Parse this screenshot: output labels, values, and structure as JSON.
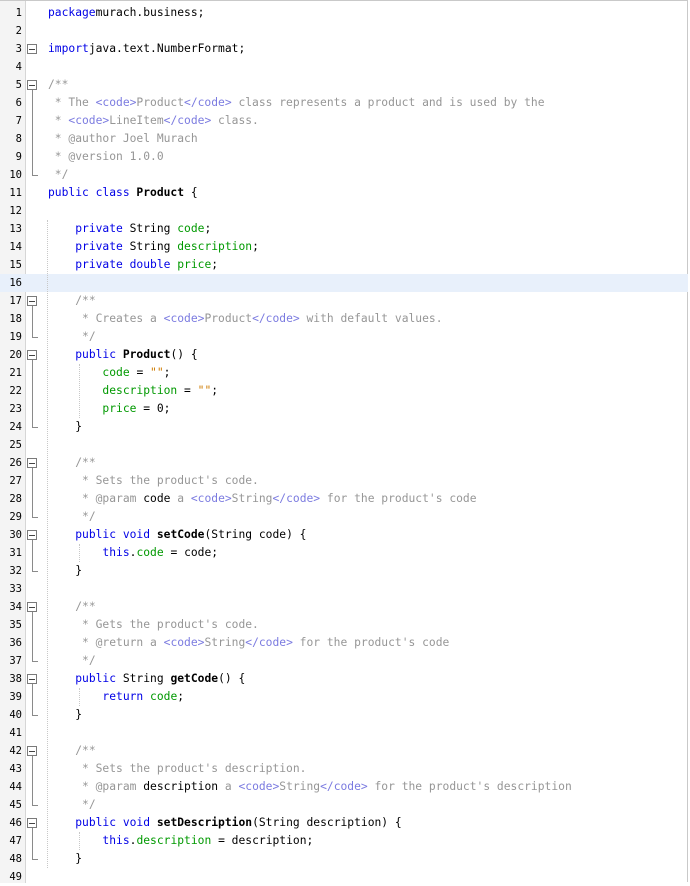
{
  "editor": {
    "lines": [
      {
        "n": "1",
        "segs": [
          [
            "kw",
            "package"
          ],
          [
            "",
            "murach.business;"
          ]
        ]
      },
      {
        "n": "2",
        "segs": []
      },
      {
        "n": "3",
        "segs": [
          [
            "kw",
            "import"
          ],
          [
            "",
            "java.text.NumberFormat;"
          ]
        ]
      },
      {
        "n": "4",
        "segs": []
      },
      {
        "n": "5",
        "segs": [
          [
            "cm",
            "/**"
          ]
        ]
      },
      {
        "n": "6",
        "segs": [
          [
            "cm",
            " * The "
          ],
          [
            "tg",
            "<code>"
          ],
          [
            "cm",
            "Product"
          ],
          [
            "tg",
            "</code>"
          ],
          [
            "cm",
            " class represents a product and is used by the"
          ]
        ]
      },
      {
        "n": "7",
        "segs": [
          [
            "cm",
            " * "
          ],
          [
            "tg",
            "<code>"
          ],
          [
            "cm",
            "LineItem"
          ],
          [
            "tg",
            "</code>"
          ],
          [
            "cm",
            " class."
          ]
        ]
      },
      {
        "n": "8",
        "segs": [
          [
            "cm",
            " * @author Joel Murach"
          ]
        ]
      },
      {
        "n": "9",
        "segs": [
          [
            "cm",
            " * @version 1.0.0"
          ]
        ]
      },
      {
        "n": "10",
        "segs": [
          [
            "cm",
            " */"
          ]
        ]
      },
      {
        "n": "11",
        "segs": [
          [
            "kw",
            "public class"
          ],
          [
            "b",
            " Product"
          ],
          [
            "",
            " {"
          ]
        ]
      },
      {
        "n": "12",
        "segs": []
      },
      {
        "n": "13",
        "segs": [
          [
            "",
            "    "
          ],
          [
            "kw",
            "private"
          ],
          [
            "",
            " String "
          ],
          [
            "fd",
            "code"
          ],
          [
            "",
            ";"
          ]
        ]
      },
      {
        "n": "14",
        "segs": [
          [
            "",
            "    "
          ],
          [
            "kw",
            "private"
          ],
          [
            "",
            " String "
          ],
          [
            "fd",
            "description"
          ],
          [
            "",
            ";"
          ]
        ]
      },
      {
        "n": "15",
        "segs": [
          [
            "",
            "    "
          ],
          [
            "kw",
            "private double"
          ],
          [
            "",
            " "
          ],
          [
            "fd",
            "price"
          ],
          [
            "",
            ";"
          ]
        ]
      },
      {
        "n": "16",
        "segs": []
      },
      {
        "n": "17",
        "segs": [
          [
            "",
            "    "
          ],
          [
            "cm",
            "/**"
          ]
        ]
      },
      {
        "n": "18",
        "segs": [
          [
            "",
            "    "
          ],
          [
            "cm",
            " * Creates a "
          ],
          [
            "tg",
            "<code>"
          ],
          [
            "cm",
            "Product"
          ],
          [
            "tg",
            "</code>"
          ],
          [
            "cm",
            " with default values."
          ]
        ]
      },
      {
        "n": "19",
        "segs": [
          [
            "",
            "    "
          ],
          [
            "cm",
            " */"
          ]
        ]
      },
      {
        "n": "20",
        "segs": [
          [
            "",
            "    "
          ],
          [
            "kw",
            "public"
          ],
          [
            "b",
            " Product"
          ],
          [
            "",
            "() {"
          ]
        ]
      },
      {
        "n": "21",
        "segs": [
          [
            "",
            "        "
          ],
          [
            "fd",
            "code"
          ],
          [
            "",
            " = "
          ],
          [
            "st",
            "\"\""
          ],
          [
            "",
            ";"
          ]
        ]
      },
      {
        "n": "22",
        "segs": [
          [
            "",
            "        "
          ],
          [
            "fd",
            "description"
          ],
          [
            "",
            " = "
          ],
          [
            "st",
            "\"\""
          ],
          [
            "",
            ";"
          ]
        ]
      },
      {
        "n": "23",
        "segs": [
          [
            "",
            "        "
          ],
          [
            "fd",
            "price"
          ],
          [
            "",
            " = 0;"
          ]
        ]
      },
      {
        "n": "24",
        "segs": [
          [
            "",
            "    }"
          ]
        ]
      },
      {
        "n": "25",
        "segs": []
      },
      {
        "n": "26",
        "segs": [
          [
            "",
            "    "
          ],
          [
            "cm",
            "/**"
          ]
        ]
      },
      {
        "n": "27",
        "segs": [
          [
            "",
            "    "
          ],
          [
            "cm",
            " * Sets the product's code."
          ]
        ]
      },
      {
        "n": "28",
        "segs": [
          [
            "",
            "    "
          ],
          [
            "cm",
            " * @param "
          ],
          [
            "",
            "code"
          ],
          [
            "cm",
            " a "
          ],
          [
            "tg",
            "<code>"
          ],
          [
            "cm",
            "String"
          ],
          [
            "tg",
            "</code>"
          ],
          [
            "cm",
            " for the product's code"
          ]
        ]
      },
      {
        "n": "29",
        "segs": [
          [
            "",
            "    "
          ],
          [
            "cm",
            " */"
          ]
        ]
      },
      {
        "n": "30",
        "segs": [
          [
            "",
            "    "
          ],
          [
            "kw",
            "public void"
          ],
          [
            "b",
            " setCode"
          ],
          [
            "",
            "(String code) {"
          ]
        ]
      },
      {
        "n": "31",
        "segs": [
          [
            "",
            "        "
          ],
          [
            "kw",
            "this"
          ],
          [
            "",
            "."
          ],
          [
            "fd",
            "code"
          ],
          [
            "",
            " = code;"
          ]
        ]
      },
      {
        "n": "32",
        "segs": [
          [
            "",
            "    }"
          ]
        ]
      },
      {
        "n": "33",
        "segs": []
      },
      {
        "n": "34",
        "segs": [
          [
            "",
            "    "
          ],
          [
            "cm",
            "/**"
          ]
        ]
      },
      {
        "n": "35",
        "segs": [
          [
            "",
            "    "
          ],
          [
            "cm",
            " * Gets the product's code."
          ]
        ]
      },
      {
        "n": "36",
        "segs": [
          [
            "",
            "    "
          ],
          [
            "cm",
            " * @return a "
          ],
          [
            "tg",
            "<code>"
          ],
          [
            "cm",
            "String"
          ],
          [
            "tg",
            "</code>"
          ],
          [
            "cm",
            " for the product's code"
          ]
        ]
      },
      {
        "n": "37",
        "segs": [
          [
            "",
            "    "
          ],
          [
            "cm",
            " */"
          ]
        ]
      },
      {
        "n": "38",
        "segs": [
          [
            "",
            "    "
          ],
          [
            "kw",
            "public"
          ],
          [
            "",
            " String "
          ],
          [
            "b",
            "getCode"
          ],
          [
            "",
            "() {"
          ]
        ]
      },
      {
        "n": "39",
        "segs": [
          [
            "",
            "        "
          ],
          [
            "kw",
            "return"
          ],
          [
            "",
            " "
          ],
          [
            "fd",
            "code"
          ],
          [
            "",
            ";"
          ]
        ]
      },
      {
        "n": "40",
        "segs": [
          [
            "",
            "    }"
          ]
        ]
      },
      {
        "n": "41",
        "segs": []
      },
      {
        "n": "42",
        "segs": [
          [
            "",
            "    "
          ],
          [
            "cm",
            "/**"
          ]
        ]
      },
      {
        "n": "43",
        "segs": [
          [
            "",
            "    "
          ],
          [
            "cm",
            " * Sets the product's description."
          ]
        ]
      },
      {
        "n": "44",
        "segs": [
          [
            "",
            "    "
          ],
          [
            "cm",
            " * @param "
          ],
          [
            "",
            "description"
          ],
          [
            "cm",
            " a "
          ],
          [
            "tg",
            "<code>"
          ],
          [
            "cm",
            "String"
          ],
          [
            "tg",
            "</code>"
          ],
          [
            "cm",
            " for the product's description"
          ]
        ]
      },
      {
        "n": "45",
        "segs": [
          [
            "",
            "    "
          ],
          [
            "cm",
            " */"
          ]
        ]
      },
      {
        "n": "46",
        "segs": [
          [
            "",
            "    "
          ],
          [
            "kw",
            "public void"
          ],
          [
            "b",
            " setDescription"
          ],
          [
            "",
            "(String description) {"
          ]
        ]
      },
      {
        "n": "47",
        "segs": [
          [
            "",
            "        "
          ],
          [
            "kw",
            "this"
          ],
          [
            "",
            "."
          ],
          [
            "fd",
            "description"
          ],
          [
            "",
            " = description;"
          ]
        ]
      },
      {
        "n": "48",
        "segs": [
          [
            "",
            "    }"
          ]
        ]
      },
      {
        "n": "49",
        "segs": []
      }
    ],
    "current_line": "16",
    "folds": [
      "3",
      "5",
      "17",
      "20",
      "26",
      "30",
      "34",
      "38",
      "42",
      "46"
    ]
  },
  "colors": {
    "keyword": "#0000e6",
    "field": "#009900",
    "comment": "#969696",
    "html_tag": "#7b7be0",
    "string": "#ce7b00",
    "current_line_bg": "#e8f0fb"
  }
}
